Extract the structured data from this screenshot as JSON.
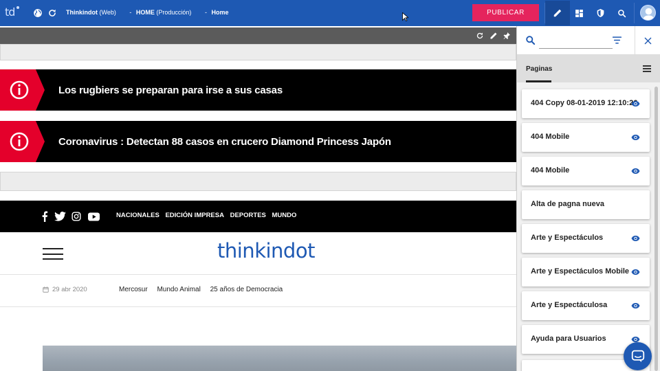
{
  "topbar": {
    "logo": "td",
    "site_name": "Thinkindot",
    "site_type": "(Web)",
    "env_name": "HOME",
    "env_type": "(Producción)",
    "page_name": "Home",
    "publish_label": "PUBLICAR",
    "accent": "#1e59b3",
    "publish_color": "#e5245d"
  },
  "alerts": [
    {
      "text": "Los rugbiers se preparan para irse a sus casas"
    },
    {
      "text": "Coronavirus : Detectan 88 casos en crucero Diamond Princess Japón"
    }
  ],
  "site": {
    "nav_links": [
      "NACIONALES",
      "EDICIÓN IMPRESA",
      "DEPORTES",
      "MUNDO"
    ],
    "brand": "thinkindot",
    "date": "29 abr 2020",
    "sub_links": [
      "Mercosur",
      "Mundo Animal",
      "25 años de Democracia"
    ]
  },
  "panel": {
    "tab_label": "Paginas",
    "pages": [
      {
        "label": "404 Copy 08-01-2019 12:10:26",
        "has_eye": true
      },
      {
        "label": "404 Mobile",
        "has_eye": true
      },
      {
        "label": "404 Mobile",
        "has_eye": true
      },
      {
        "label": "Alta de pagna nueva",
        "has_eye": false
      },
      {
        "label": "Arte y Espectáculos",
        "has_eye": true
      },
      {
        "label": "Arte y Espectáculos Mobile",
        "has_eye": true
      },
      {
        "label": "Arte y Espectáculosa",
        "has_eye": true
      },
      {
        "label": "Ayuda para Usuarios",
        "has_eye": true
      }
    ]
  }
}
